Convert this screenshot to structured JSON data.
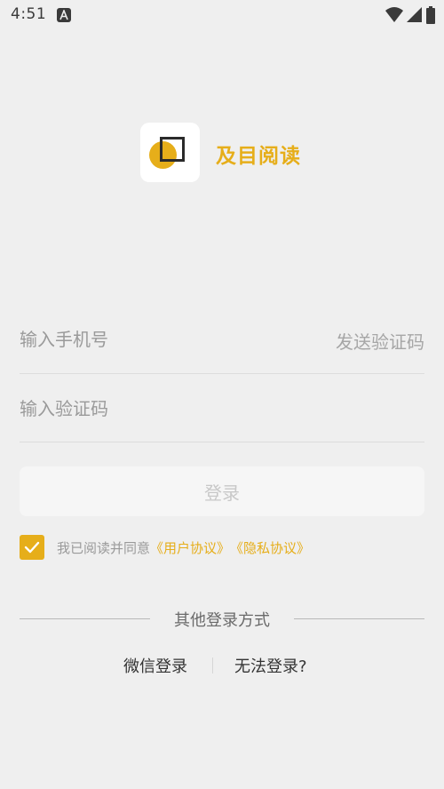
{
  "status_bar": {
    "time": "4:51",
    "app_icon": "a-letter-icon",
    "icons": [
      "wifi-icon",
      "signal-icon",
      "battery-icon"
    ]
  },
  "app": {
    "name": "及目阅读",
    "accent_color": "#e6ae1a"
  },
  "form": {
    "phone_placeholder": "输入手机号",
    "send_code_label": "发送验证码",
    "code_placeholder": "输入验证码",
    "login_label": "登录",
    "login_enabled": false
  },
  "agreement": {
    "checked": true,
    "text": "我已阅读并同意",
    "user_agreement": "《用户协议》",
    "privacy_policy": "《隐私协议》"
  },
  "other_login": {
    "divider_text": "其他登录方式",
    "wechat_label": "微信登录",
    "cant_login_label": "无法登录?"
  }
}
